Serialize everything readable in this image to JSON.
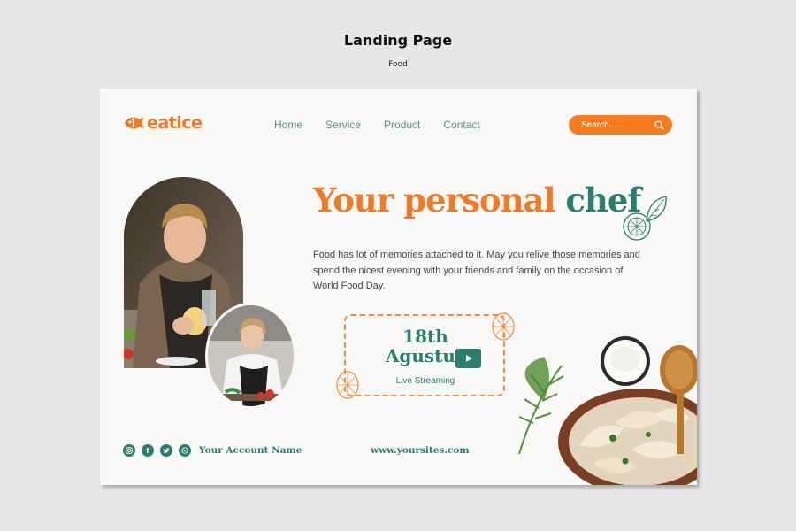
{
  "header": {
    "title": "Landing Page",
    "subtitle": "Food"
  },
  "brand": {
    "name": "eatice",
    "accent": "#f07a25",
    "secondary": "#2a7e6e",
    "icon": "fish-logo-icon"
  },
  "nav": {
    "items": [
      {
        "label": "Home"
      },
      {
        "label": "Service"
      },
      {
        "label": "Product"
      },
      {
        "label": "Contact"
      }
    ]
  },
  "search": {
    "placeholder": "Search......",
    "icon": "search-icon"
  },
  "hero": {
    "headline_part1": "Your personal",
    "headline_part2": "chef",
    "description": "Food has lot of memories attached to it. May you relive those memories and spend the nicest evening with your friends and family on the occasion of World Food Day."
  },
  "event": {
    "date_line1": "18th",
    "date_line2": "Agustus",
    "live_label": "Live Streaming",
    "icon": "play-icon"
  },
  "footer": {
    "socials": [
      {
        "icon": "instagram-icon"
      },
      {
        "icon": "facebook-icon"
      },
      {
        "icon": "twitter-icon"
      },
      {
        "icon": "whatsapp-icon"
      }
    ],
    "account_name": "Your Account Name",
    "website": "www.yoursites.com"
  }
}
